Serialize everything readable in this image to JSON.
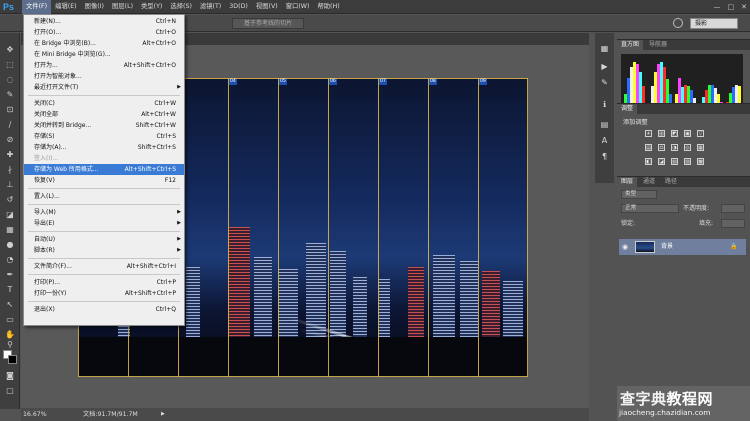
{
  "app": {
    "logo": "Ps"
  },
  "menubar": [
    {
      "label": "文件(F)",
      "active": true
    },
    {
      "label": "编辑(E)"
    },
    {
      "label": "图像(I)"
    },
    {
      "label": "图层(L)"
    },
    {
      "label": "类型(Y)"
    },
    {
      "label": "选择(S)"
    },
    {
      "label": "滤镜(T)"
    },
    {
      "label": "3D(D)"
    },
    {
      "label": "视图(V)"
    },
    {
      "label": "窗口(W)"
    },
    {
      "label": "帮助(H)"
    }
  ],
  "window_controls": [
    "—",
    "□",
    "✕"
  ],
  "options_bar": {
    "slice_button": "基于参考线的切片",
    "workspace": "摄影"
  },
  "file_menu": [
    {
      "label": "新建(N)...",
      "shortcut": "Ctrl+N"
    },
    {
      "label": "打开(O)...",
      "shortcut": "Ctrl+O"
    },
    {
      "label": "在 Bridge 中浏览(B)...",
      "shortcut": "Alt+Ctrl+O"
    },
    {
      "label": "在 Mini Bridge 中浏览(G)...",
      "shortcut": ""
    },
    {
      "label": "打开为...",
      "shortcut": "Alt+Shift+Ctrl+O"
    },
    {
      "label": "打开为智能对象...",
      "shortcut": ""
    },
    {
      "label": "最近打开文件(T)",
      "shortcut": "",
      "submenu": true
    },
    {
      "sep": true
    },
    {
      "label": "关闭(C)",
      "shortcut": "Ctrl+W"
    },
    {
      "label": "关闭全部",
      "shortcut": "Alt+Ctrl+W"
    },
    {
      "label": "关闭并转到 Bridge...",
      "shortcut": "Shift+Ctrl+W"
    },
    {
      "label": "存储(S)",
      "shortcut": "Ctrl+S"
    },
    {
      "label": "存储为(A)...",
      "shortcut": "Shift+Ctrl+S"
    },
    {
      "label": "签入(I)...",
      "shortcut": "",
      "disabled": true
    },
    {
      "label": "存储为 Web 所用格式...",
      "shortcut": "Alt+Shift+Ctrl+S",
      "highlighted": true
    },
    {
      "label": "恢复(V)",
      "shortcut": "F12"
    },
    {
      "sep": true
    },
    {
      "label": "置入(L)...",
      "shortcut": ""
    },
    {
      "sep": true
    },
    {
      "label": "导入(M)",
      "shortcut": "",
      "submenu": true
    },
    {
      "label": "导出(E)",
      "shortcut": "",
      "submenu": true
    },
    {
      "sep": true
    },
    {
      "label": "自动(U)",
      "shortcut": "",
      "submenu": true
    },
    {
      "label": "脚本(R)",
      "shortcut": "",
      "submenu": true
    },
    {
      "sep": true
    },
    {
      "label": "文件简介(F)...",
      "shortcut": "Alt+Shift+Ctrl+I"
    },
    {
      "sep": true
    },
    {
      "label": "打印(P)...",
      "shortcut": "Ctrl+P"
    },
    {
      "label": "打印一份(Y)",
      "shortcut": "Alt+Shift+Ctrl+P"
    },
    {
      "sep": true
    },
    {
      "label": "退出(X)",
      "shortcut": "Ctrl+Q"
    }
  ],
  "slices": [
    "04",
    "05",
    "06",
    "07",
    "08",
    "09"
  ],
  "status": {
    "zoom": "16.67%",
    "doc": "文档:91.7M/91.7M",
    "arrow": "▶"
  },
  "panels": {
    "histogram_tabs": [
      "直方图",
      "导航器"
    ],
    "adjust_tab": "调整",
    "adjust_title": "添加调整",
    "adjust_icons": [
      "☀",
      "▥",
      "◩",
      "▣",
      "▽",
      "▤",
      "⚖",
      "◑",
      "◎",
      "▦",
      "◧",
      "◪",
      "▧",
      "▨",
      "▩"
    ],
    "layers_tabs": [
      "图层",
      "通道",
      "路径"
    ],
    "kind": "类型",
    "blend": "正常",
    "opacity": "不透明度:",
    "lock": "锁定:",
    "fill": "填充:",
    "layer_name": "背景"
  },
  "watermark": {
    "main_a": "查字典",
    "main_b": "教程网",
    "sub": "jiaocheng.chazidian.com"
  }
}
